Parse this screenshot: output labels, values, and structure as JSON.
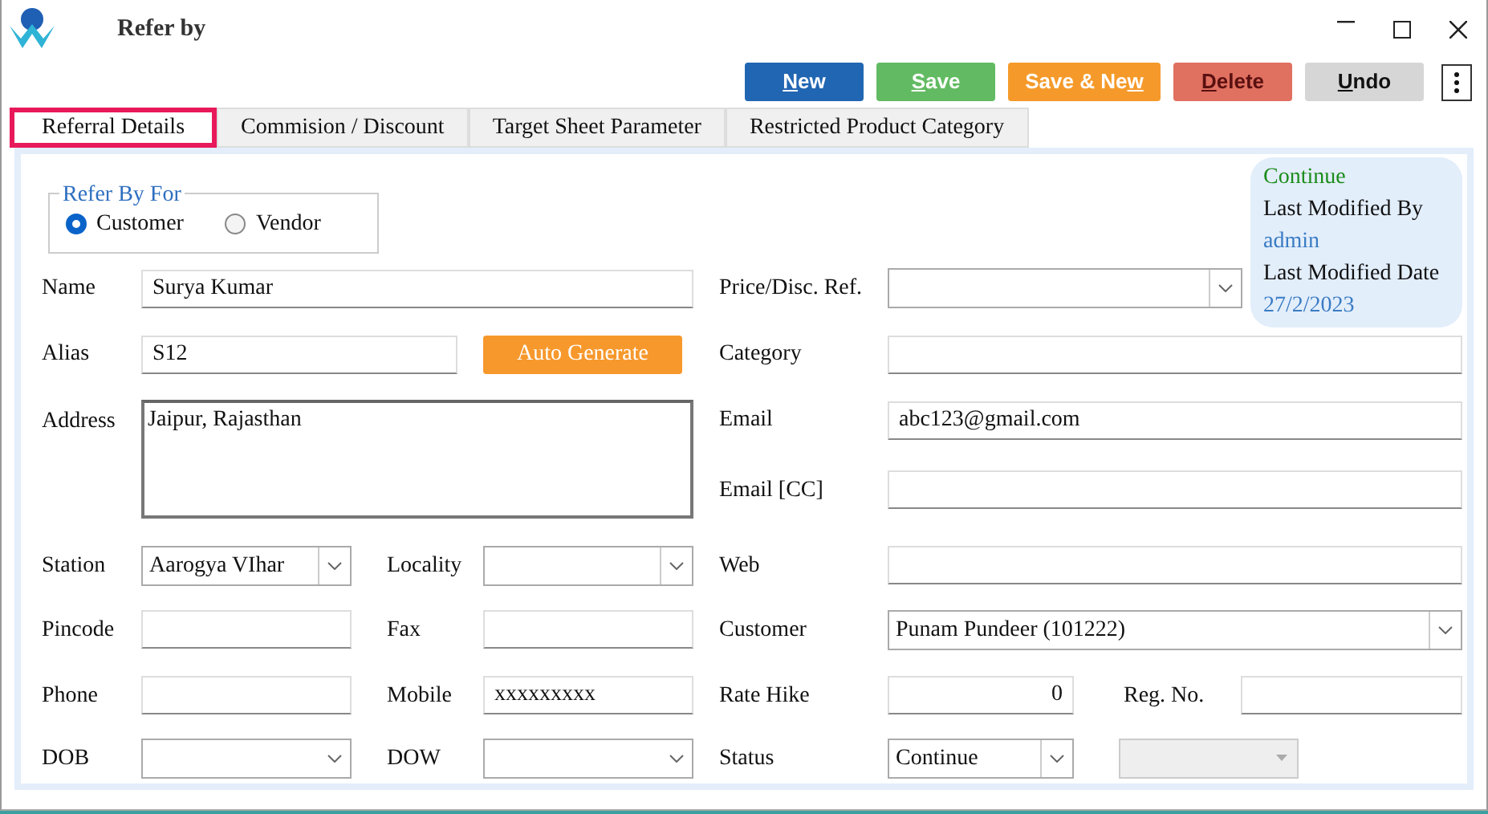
{
  "window": {
    "title": "Refer by"
  },
  "toolbar": [
    {
      "access_key": "N",
      "after": "ew",
      "kind": "primary"
    },
    {
      "access_key": "S",
      "after": "ave",
      "kind": "success"
    },
    {
      "before": "Save & Ne",
      "access_key": "w",
      "kind": "warning"
    },
    {
      "access_key": "D",
      "after": "elete",
      "kind": "danger"
    },
    {
      "access_key": "U",
      "after": "ndo",
      "kind": "secondary"
    }
  ],
  "tabs": [
    {
      "label": "Referral Details",
      "selected": true
    },
    {
      "label": "Commision / Discount",
      "selected": false
    },
    {
      "label": "Target Sheet Parameter",
      "selected": false
    },
    {
      "label": "Restricted Product Category",
      "selected": false
    }
  ],
  "refer_by_for": {
    "legend": "Refer By For",
    "options": [
      {
        "label": "Customer",
        "selected": true
      },
      {
        "label": "Vendor",
        "selected": false
      }
    ]
  },
  "info": {
    "status": "Continue",
    "modified_by_label": "Last Modified By",
    "modified_by": "admin",
    "modified_date_label": "Last Modified Date",
    "modified_date": "27/2/2023"
  },
  "fields": [
    {
      "label": "Name",
      "kind": "text",
      "value": "Surya Kumar"
    },
    {
      "label": "Price/Disc. Ref.",
      "kind": "select"
    },
    {
      "label": "Alias",
      "kind": "text",
      "value": "S12"
    },
    {
      "kind": "button",
      "value": "Auto Generate"
    },
    {
      "label": "Category",
      "kind": "text"
    },
    {
      "label": "Address",
      "kind": "textarea",
      "value": "Jaipur, Rajasthan"
    },
    {
      "label": "Email",
      "kind": "text",
      "value": "abc123@gmail.com"
    },
    {
      "label": "Email [CC]",
      "kind": "text"
    },
    {
      "label": "Station",
      "kind": "select",
      "value": "Aarogya VIhar"
    },
    {
      "label": "Locality",
      "kind": "select"
    },
    {
      "label": "Web",
      "kind": "text"
    },
    {
      "label": "Pincode",
      "kind": "text"
    },
    {
      "label": "Fax",
      "kind": "text"
    },
    {
      "label": "Customer",
      "kind": "select",
      "value": "Punam Pundeer (101222)"
    },
    {
      "label": "Phone",
      "kind": "text"
    },
    {
      "label": "Mobile",
      "kind": "text",
      "value": "xxxxxxxxx"
    },
    {
      "label": "Rate Hike",
      "kind": "number",
      "value": "0"
    },
    {
      "label": "Reg. No.",
      "kind": "text"
    },
    {
      "label": "DOB",
      "kind": "date"
    },
    {
      "label": "DOW",
      "kind": "date"
    },
    {
      "label": "Status",
      "kind": "select",
      "value": "Continue"
    },
    {
      "kind": "select",
      "disabled": true
    }
  ]
}
